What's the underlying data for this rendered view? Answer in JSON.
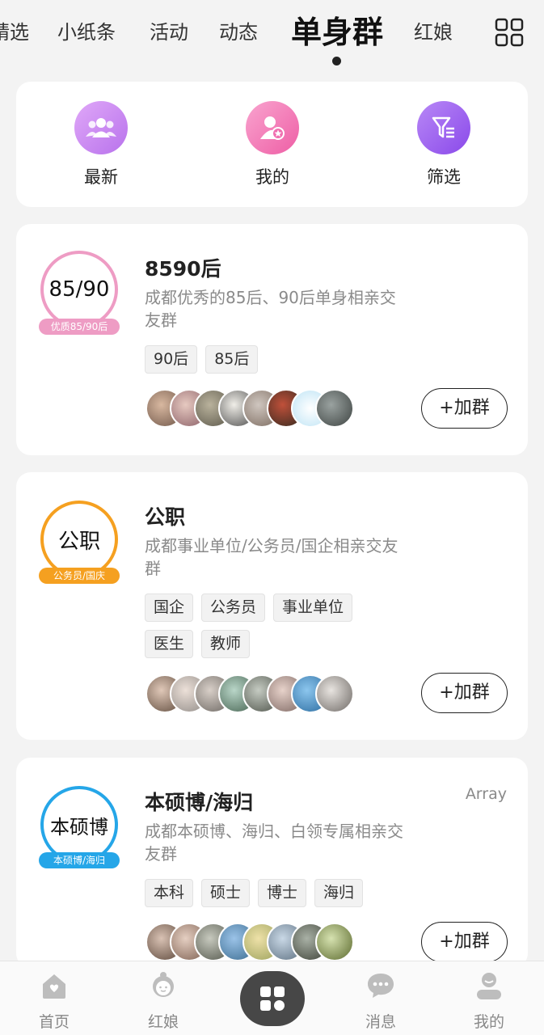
{
  "top_tabs": [
    "精选",
    "小纸条",
    "活动",
    "动态",
    "单身群",
    "红娘"
  ],
  "active_tab": "单身群",
  "quick_actions": [
    {
      "label": "最新",
      "icon": "group-icon",
      "color": "#c17ef0"
    },
    {
      "label": "我的",
      "icon": "user-star-icon",
      "color": "#f06fb0"
    },
    {
      "label": "筛选",
      "icon": "filter-icon",
      "color": "#9b5cf0"
    }
  ],
  "groups": [
    {
      "badge_text": "85/90",
      "badge_tag": "优质85/90后",
      "badge_color": "#ee9cc4",
      "title": "8590后",
      "description": "成都优秀的85后、90后单身相亲交友群",
      "tags": [
        "90后",
        "85后"
      ],
      "extra": "",
      "join_label": "+加群",
      "avatar_count": 8
    },
    {
      "badge_text": "公职",
      "badge_tag": "公务员/国庆",
      "badge_color": "#f5a020",
      "title": "公职",
      "description": "成都事业单位/公务员/国企相亲交友群",
      "tags": [
        "国企",
        "公务员",
        "事业单位",
        "医生",
        "教师"
      ],
      "extra": "",
      "join_label": "+加群",
      "avatar_count": 8
    },
    {
      "badge_text": "本硕博",
      "badge_tag": "本硕博/海归",
      "badge_color": "#25a6e8",
      "title": "本硕博/海归",
      "description": "成都本硕博、海归、白领专属相亲交友群",
      "tags": [
        "本科",
        "硕士",
        "博士",
        "海归"
      ],
      "extra": "Array",
      "join_label": "+加群",
      "avatar_count": 8
    }
  ],
  "bottom_nav": [
    {
      "label": "首页",
      "icon": "home-icon"
    },
    {
      "label": "红娘",
      "icon": "matchmaker-icon"
    },
    {
      "label": "",
      "icon": "apps-icon"
    },
    {
      "label": "消息",
      "icon": "chat-icon"
    },
    {
      "label": "我的",
      "icon": "profile-icon"
    }
  ]
}
